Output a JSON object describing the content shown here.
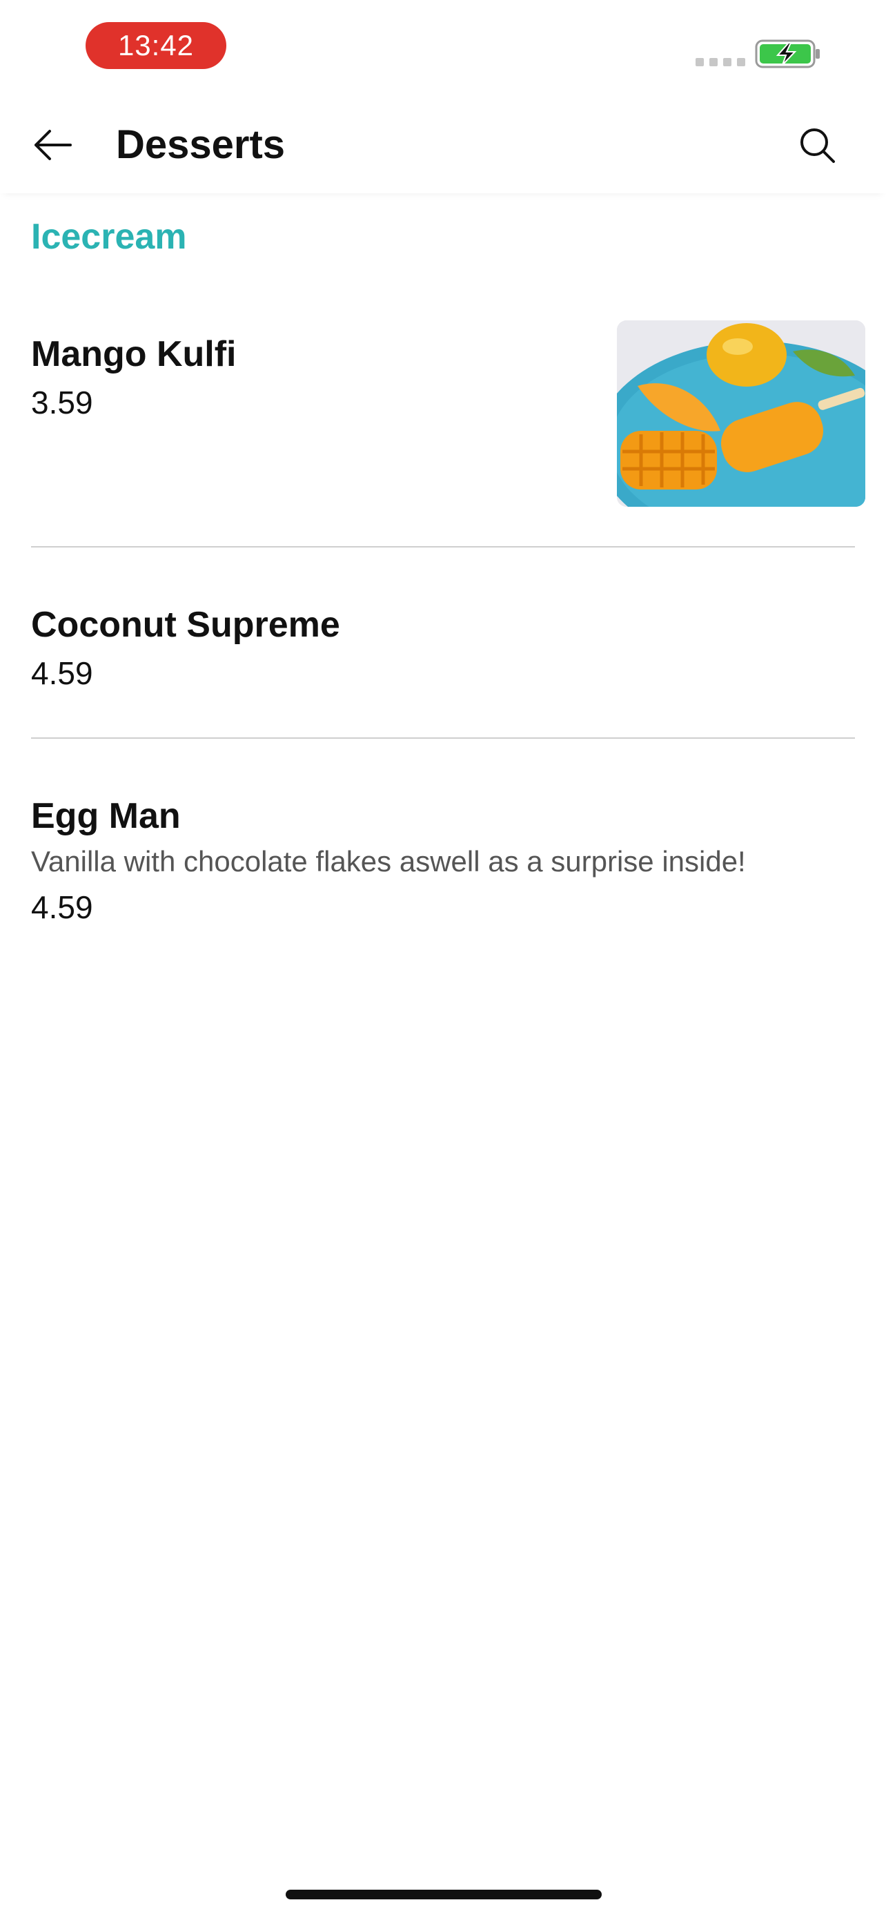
{
  "status_bar": {
    "time": "13:42",
    "time_pill_color": "#e0322b",
    "battery_icon": "battery-charging-icon",
    "signal_icon": "signal-dots-icon"
  },
  "nav": {
    "title": "Desserts",
    "back_icon": "arrow-left-icon",
    "search_icon": "search-icon"
  },
  "section": {
    "heading": "Icecream",
    "accent_color": "#2bb3b3"
  },
  "items": [
    {
      "name": "Mango Kulfi",
      "price": "3.59",
      "image": "mango-kulfi-photo"
    },
    {
      "name": "Coconut Supreme",
      "price": "4.59"
    },
    {
      "name": "Egg Man",
      "description": "Vanilla with chocolate flakes aswell as a surprise inside!",
      "price": "4.59"
    }
  ]
}
